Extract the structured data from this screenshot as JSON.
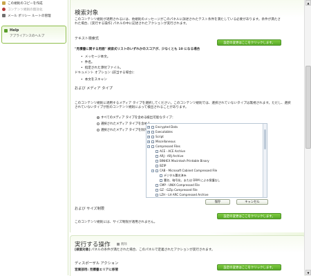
{
  "nav": {
    "items": [
      {
        "label": "この規則のコピーを作成",
        "style": "normal",
        "icon_color": "#c9a54b"
      },
      {
        "label": "コンテンツ規則の無効化",
        "style": "muted",
        "icon_color": "#b53a3a"
      },
      {
        "label": "メール ポリシー ルートの管理",
        "style": "normal",
        "icon_color": "#6f6f6f"
      }
    ],
    "help": {
      "title": "Help",
      "subtitle": "アプライアンスのヘルプ"
    }
  },
  "condition": {
    "title": "検索対象",
    "intro_line1": "このコンテンツ規則が適用されるには、他規則のメッセージがこのパネルに詳述されたテスト条件を満たしている必要があります。条件が満たさ",
    "intro_line2": "れた場合、[実行する操作] パネルの中に記述されたアクションが実行されます。",
    "text_search_label": "テキスト検索式",
    "change_btn": "設定の変更はここをクリックします。",
    "words_line": "\"見積書に関する用語\" 検索式リストのいずれかのスコアが、少なくとも 10 になる場合",
    "bullets": [
      "メッセージ本文。",
      "件名。",
      "指定された添付ファイル。"
    ],
    "doc_options": "ドキュメント オプション (該当する場合)：",
    "doc_bullets": [
      "本文をスキャン"
    ],
    "media_title": "および メディア タイプ",
    "media_desc1": "このコンテンツ規則に適用するメディア タイプを選択してください。このコンテンツ規則では、選択されていないタイプは無視されます。ただし、選択",
    "media_desc2": "されていないタイプが別のコンテンツ規則によって検出されることがあります。",
    "radios": [
      {
        "label": "すべてのメディア タイプを含める",
        "selected": true
      },
      {
        "label": "選択されたメディア タイプを含める",
        "selected": false
      },
      {
        "label": "選択されたメディア タイプを除外する",
        "selected": false
      }
    ],
    "detect_label": "検出可能なタイプ：",
    "tree": [
      {
        "label": "Encrypted Data",
        "level": 0,
        "exp": "+"
      },
      {
        "label": "Executables",
        "level": 0,
        "exp": "+"
      },
      {
        "label": "Script",
        "level": 0,
        "exp": "+"
      },
      {
        "label": "Miscellaneous",
        "level": 0,
        "exp": "+"
      },
      {
        "label": "Compressed Files",
        "level": 0,
        "exp": "−"
      },
      {
        "label": "ACE - ACE Archive",
        "level": 1,
        "exp": ""
      },
      {
        "label": "ARJ - ARJ Archive",
        "level": 1,
        "exp": ""
      },
      {
        "label": "BINHEX Macintosh Printable Binary",
        "level": 1,
        "exp": ""
      },
      {
        "label": "BZIP",
        "level": 1,
        "exp": ""
      },
      {
        "label": "CAB - Microsoft Cabinet Compressed File",
        "level": 1,
        "exp": "−"
      },
      {
        "label": "デジタル署名済み",
        "level": 2,
        "exp": ""
      },
      {
        "label": "署名、暗号化、または DRM による保護なし",
        "level": 2,
        "exp": ""
      },
      {
        "label": "CMP - UNIX Compressed File",
        "level": 1,
        "exp": ""
      },
      {
        "label": "GZ - GZip Compressed File",
        "level": 1,
        "exp": ""
      },
      {
        "label": "LZH - LH ARC Compressed Archive",
        "level": 1,
        "exp": ""
      }
    ],
    "save_btn": "保存",
    "cancel_btn": "キャンセル",
    "size_title": "および サイズ制限",
    "size_desc": "このコンテンツ規則には、サイズ制限が適用されません。"
  },
  "action": {
    "title": "実行する操作",
    "help_link": "削除",
    "desc_prefix": "[検索対象]",
    "desc": " パネルの条件が満たされた場合、このパネルで定義されたアクションが実行されます。",
    "disposal_title": "ディスポーザル アクション",
    "change_btn": "設定の変更はここをクリックします。",
    "disposal_label": "営業部用:",
    "disposal_value": "見積書エリアに移管"
  },
  "scrollbar": {
    "up": "▲",
    "down": "▼"
  }
}
